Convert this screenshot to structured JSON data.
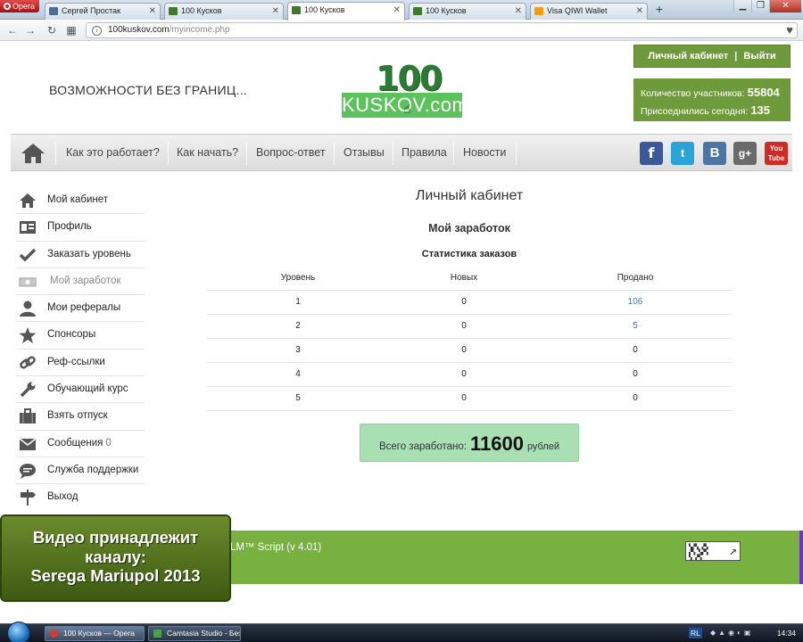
{
  "browser": {
    "opera_label": "Opera",
    "tabs": [
      {
        "label": "Сергей Простак",
        "icon": "vk"
      },
      {
        "label": "100 Кусков",
        "icon": "kuskov"
      },
      {
        "label": "100 Кусков",
        "icon": "kuskov",
        "active": true
      },
      {
        "label": "100 Кусков",
        "icon": "kuskov"
      },
      {
        "label": "Visa QIWI Wallet",
        "icon": "qiwi"
      }
    ],
    "new_tab": "+",
    "url_host": "100kuskov.com",
    "url_path": "/myincome.php"
  },
  "header": {
    "slogan": "ВОЗМОЖНОСТИ БЕЗ ГРАНИЦ...",
    "logo_number": "100",
    "logo_text": "KUSKOV.com",
    "account_link": "Личный кабинет",
    "account_sep": "|",
    "logout_link": "Выйти",
    "participants_label": "Количество участников:",
    "participants_value": "55804",
    "joined_today_label": "Присоеднились сегодня:",
    "joined_today_value": "135"
  },
  "nav": {
    "items": [
      "Как это работает?",
      "Как начать?",
      "Вопрос-ответ",
      "Отзывы",
      "Правила",
      "Новости"
    ],
    "social": [
      "f",
      "t",
      "B",
      "g+",
      "You Tube"
    ]
  },
  "sidebar": {
    "items": [
      {
        "label": "Мой кабинет",
        "icon": "home-icon"
      },
      {
        "label": "Профиль",
        "icon": "id-card-icon"
      },
      {
        "label": "Заказать уровень",
        "icon": "checkmark-icon"
      },
      {
        "label": "Мой заработок",
        "icon": "money-icon",
        "current": true
      },
      {
        "label": "Мои рефералы",
        "icon": "person-icon"
      },
      {
        "label": "Спонсоры",
        "icon": "star-icon"
      },
      {
        "label": "Реф-ссылки",
        "icon": "link-icon"
      },
      {
        "label": "Обучающий курс",
        "icon": "wrench-icon"
      },
      {
        "label": "Взять отпуск",
        "icon": "suitcase-icon"
      },
      {
        "label": "Сообщения",
        "icon": "envelope-icon",
        "count": "0"
      },
      {
        "label": "Служба поддержки",
        "icon": "chat-icon"
      },
      {
        "label": "Выход",
        "icon": "signpost-icon"
      }
    ]
  },
  "content": {
    "title": "Личный кабинет",
    "section_title": "Мой заработок",
    "stats_title": "Статистика заказов",
    "columns": [
      "Уровень",
      "Новых",
      "Продано"
    ],
    "rows": [
      [
        "1",
        "0",
        "106"
      ],
      [
        "2",
        "0",
        "5"
      ],
      [
        "3",
        "0",
        "0"
      ],
      [
        "4",
        "0",
        "0"
      ],
      [
        "5",
        "0",
        "0"
      ]
    ],
    "total_label": "Всего заработано:",
    "total_value": "11600",
    "total_currency": "рублей"
  },
  "footer": {
    "copyright": "LM™ Script (v 4.01)"
  },
  "watermark": {
    "line1": "Видео принадлежит",
    "line2": "каналу:",
    "line3": "Serega Mariupol 2013"
  },
  "taskbar": {
    "buttons": [
      "100 Кусков — Opera",
      "Camtasia Studio - Без..."
    ],
    "lang": "RL",
    "clock": "14:34"
  },
  "colors": {
    "brand_green": "#6f9a3b",
    "footer_green": "#78b13f",
    "total_box": "#a8e0b4"
  }
}
